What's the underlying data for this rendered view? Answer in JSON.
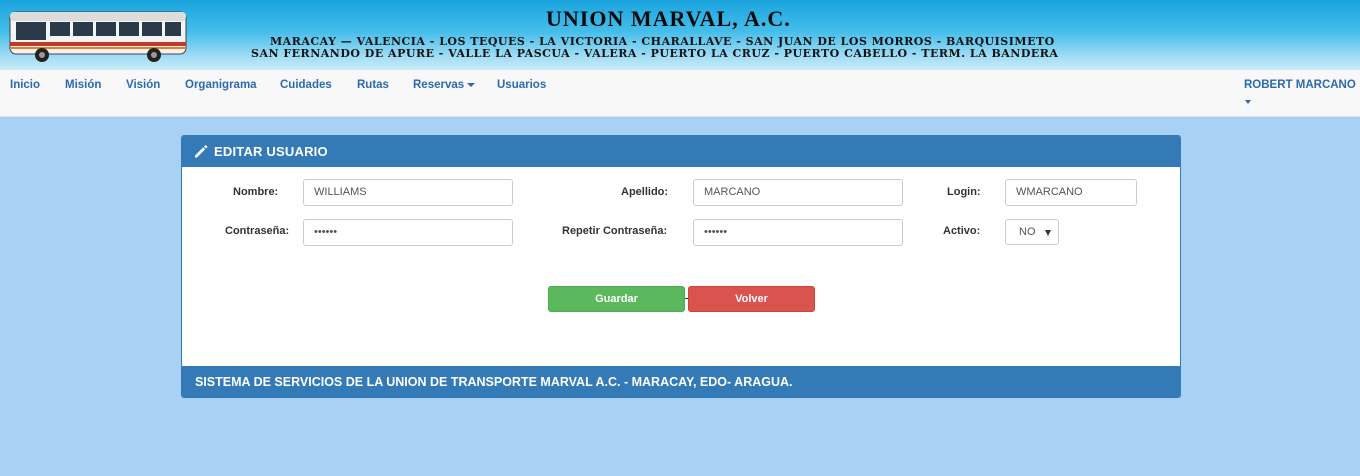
{
  "banner": {
    "title": "UNION MARVAL, A.C.",
    "routes_line1": "MARACAY — VALENCIA - LOS TEQUES - LA VICTORIA - CHARALLAVE - SAN JUAN DE LOS MORROS - BARQUISIMETO",
    "routes_line2": "SAN FERNANDO DE APURE - VALLE LA PASCUA - VALERA - PUERTO LA CRUZ - PUERTO CABELLO - TERM. LA BANDERA"
  },
  "nav": {
    "items": [
      "Inicio",
      "Misión",
      "Visión",
      "Organigrama",
      "Cuidades",
      "Rutas",
      "Reservas",
      "Usuarios"
    ],
    "user": "ROBERT MARCANO"
  },
  "panel": {
    "title": "EDITAR USUARIO",
    "fields": {
      "nombre": {
        "label": "Nombre:",
        "value": "WILLIAMS"
      },
      "apellido": {
        "label": "Apellido:",
        "value": "MARCANO"
      },
      "login": {
        "label": "Login:",
        "value": "WMARCANO"
      },
      "password": {
        "label": "Contraseña:",
        "value": "••••••"
      },
      "password_repeat": {
        "label": "Repetir Contraseña:",
        "value": "••••••"
      },
      "activo": {
        "label": "Activo:",
        "value": "NO"
      }
    },
    "buttons": {
      "save": "Guardar",
      "back": "Volver"
    },
    "footer": "SISTEMA DE SERVICIOS DE LA UNION DE TRANSPORTE MARVAL A.C. - MARACAY, EDO- ARAGUA."
  },
  "colors": {
    "page_bg": "#a9d0f5",
    "primary": "#337ab7",
    "success": "#5cb85c",
    "danger": "#d9534f",
    "nav_link": "#2a6ab0"
  }
}
